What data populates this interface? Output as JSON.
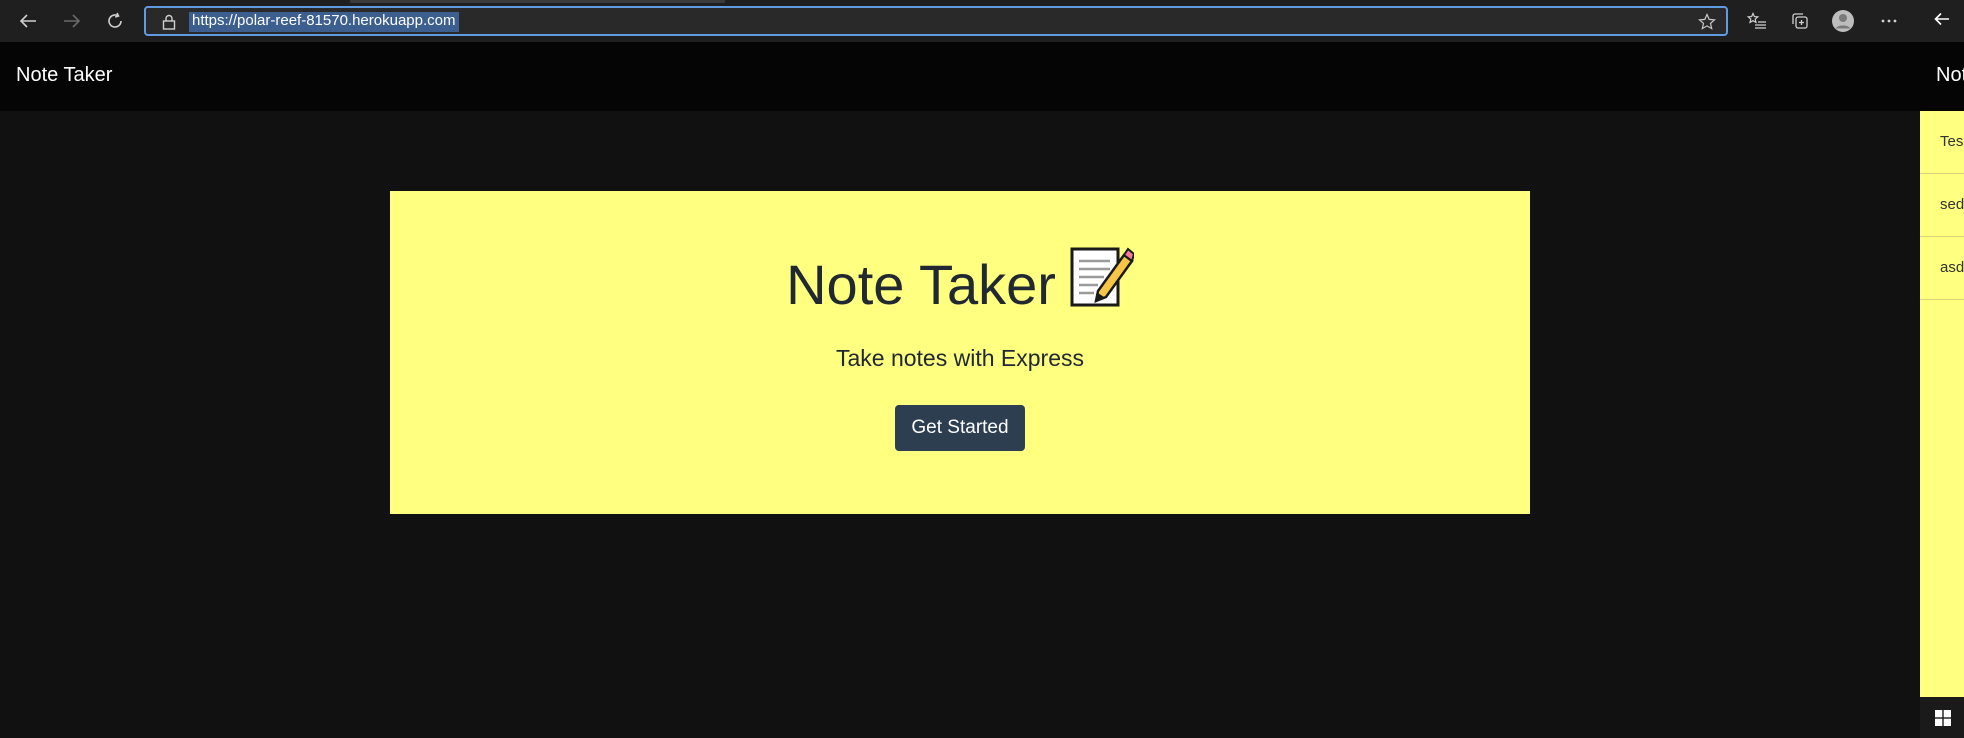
{
  "browser": {
    "url": "https://polar-reef-81570.herokuapp.com",
    "icons": {
      "back": "back-arrow-icon",
      "forward": "forward-arrow-icon",
      "refresh": "refresh-icon",
      "lock": "lock-icon",
      "favorite": "star-icon",
      "favorites": "favorites-list-icon",
      "collections": "collections-icon",
      "profile": "profile-avatar-icon",
      "menu": "more-menu-icon"
    }
  },
  "navbar": {
    "brand": "Note Taker"
  },
  "hero": {
    "title": "Note Taker",
    "emoji": "memo-icon",
    "subtitle": "Take notes with Express",
    "button_label": "Get Started"
  },
  "side_window": {
    "brand": "Not",
    "items": [
      {
        "label": "Tes"
      },
      {
        "label": "sed"
      },
      {
        "label": "asd"
      }
    ]
  },
  "colors": {
    "page_background": "#111111",
    "navbar": "#050505",
    "jumbotron": "#ffff80",
    "button": "#2c3e50",
    "address_focus": "#5f9be0"
  }
}
